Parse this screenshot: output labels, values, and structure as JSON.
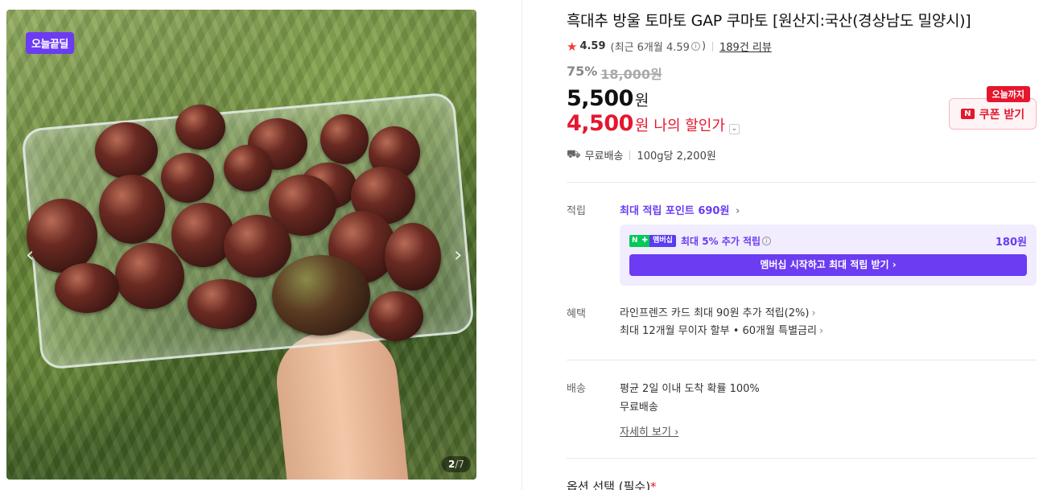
{
  "gallery": {
    "badge": "오늘끝딜",
    "prev_icon": "chevron-left-icon",
    "next_icon": "chevron-right-icon",
    "page_current": "2",
    "page_sep": "/",
    "page_total": "7"
  },
  "product": {
    "title": "흑대추 방울 토마토 GAP 쿠마토 [원산지:국산(경상남도 밀양시)]",
    "rating": "4.59",
    "recent_rating": "(최근 6개월 4.59",
    "recent_rating_close": ")",
    "review_count": "189건 리뷰",
    "discount_rate": "75%",
    "original_price": "18,000원",
    "price": "5,500",
    "price_unit": "원",
    "my_price": "4,500",
    "my_price_unit": "원",
    "my_price_label": "나의 할인가",
    "coupon_tag": "오늘까지",
    "coupon_label": "쿠폰 받기",
    "shipping": "무료배송",
    "unit_price": "100g당 2,200원"
  },
  "points": {
    "label": "적립",
    "max_points": "최대 적립 포인트",
    "max_points_amount": "690원",
    "membership_badge": "멤버십",
    "membership_text": "최대 5% 추가 적립",
    "membership_amount": "180원",
    "membership_button": "멤버십 시작하고 최대 적립 받기"
  },
  "benefits": {
    "label": "혜택",
    "line1": "라인프렌즈 카드 최대 90원 추가 적립(2%)",
    "line2": "최대 12개월 무이자 할부 • 60개월 특별금리"
  },
  "delivery": {
    "label": "배송",
    "line1": "평균 2일 이내 도착 확률 100%",
    "line2": "무료배송",
    "detail_link": "자세히 보기"
  },
  "option": {
    "label": "옵션 선택 (필수)",
    "required_mark": "*"
  },
  "colors": {
    "accent_purple": "#6b3cf2",
    "sale_red": "#e5172f",
    "star_red": "#f53b30"
  }
}
